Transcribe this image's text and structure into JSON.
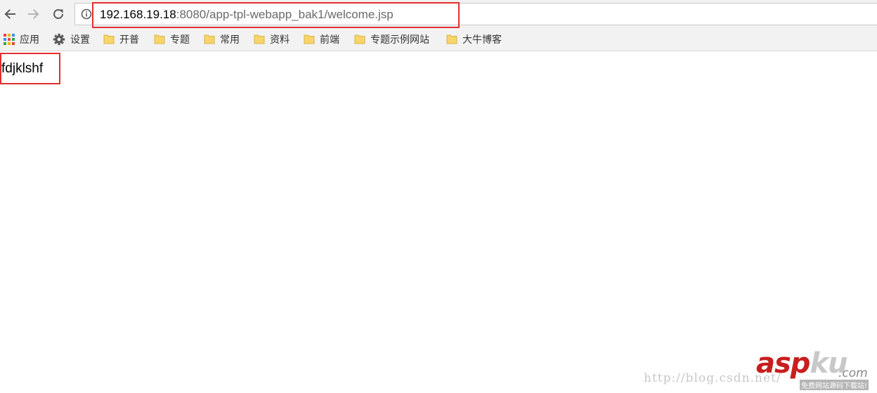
{
  "address_bar": {
    "url_host": "192.168.19.18",
    "url_rest": ":8080/app-tpl-webapp_bak1/welcome.jsp"
  },
  "icons": {
    "back": "arrow-left-icon",
    "forward": "arrow-right-icon",
    "reload": "reload-icon",
    "info": "info-icon",
    "apps": "apps-grid-icon",
    "settings": "gear-icon",
    "folder": "folder-icon"
  },
  "bookmarks": {
    "apps_label": "应用",
    "settings_label": "设置",
    "folders": [
      "开普",
      "专题",
      "常用",
      "资料",
      "前端",
      "专题示例网站",
      "大牛博客"
    ]
  },
  "page": {
    "body_text": "fdjklshf"
  },
  "watermark": {
    "url": "http://blog.csdn.net/",
    "logo_asp": "asp",
    "logo_ku": "ku",
    "logo_com": ".com",
    "tagline": "免费网站源码下载站!"
  },
  "colors": {
    "annotation_box": "#e03030",
    "toolbar_bg": "#f2f2f2",
    "folder_yellow": "#f7d56a",
    "watermark_red": "#c81e1e"
  }
}
